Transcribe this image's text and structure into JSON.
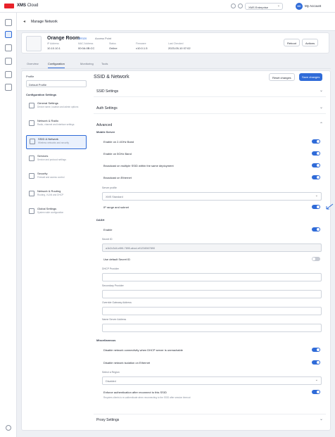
{
  "topbar": {
    "brand_bold": "XMS",
    "brand_rest": "Cloud",
    "account": "XMS Enterprise",
    "avatar_initials": "XC",
    "user_name": "My Account"
  },
  "breadcrumb": {
    "title": "Manage Network"
  },
  "room": {
    "name": "Orange Room",
    "badge": "XR320",
    "subtitle": "Access Point",
    "meta": [
      {
        "label": "IP Address",
        "value": "10.10.10.1"
      },
      {
        "label": "MAC Address",
        "value": "00:0A:0B:CC"
      },
      {
        "label": "Status",
        "value": "Online"
      },
      {
        "label": "Firmware",
        "value": "v10.0.1.5"
      },
      {
        "label": "Last Checked",
        "value": "2023-05-10 07:02"
      }
    ],
    "buttons": {
      "reboot": "Reboot",
      "more": "Actions"
    }
  },
  "tabs": [
    "Overview",
    "Configuration",
    "Monitoring",
    "Tools"
  ],
  "left": {
    "profile_label": "Profile",
    "profile_value": "Default Profile",
    "section": "Configuration Settings",
    "items": [
      {
        "title": "General Settings",
        "desc": "Device name, location and admin options"
      },
      {
        "title": "Network & Radio",
        "desc": "Radio, channel and interface settings"
      },
      {
        "title": "SSID & Network",
        "desc": "Wireless networks and security"
      },
      {
        "title": "Services",
        "desc": "Service and protocol settings"
      },
      {
        "title": "Security",
        "desc": "Firewall and access control"
      },
      {
        "title": "Network & Routing",
        "desc": "Routing, VLAN and DHCP"
      },
      {
        "title": "Global Settings",
        "desc": "System wide configuration"
      }
    ]
  },
  "content": {
    "title": "SSID & Network",
    "btn_outline": "Reset changes",
    "btn_primary": "Save changes",
    "sections": {
      "ssid": "SSID Settings",
      "auth": "Auth Settings",
      "advanced": "Advanced",
      "proxy": "Proxy Settings"
    },
    "mobile_heading": "Mobile Server",
    "mobile_rows": [
      {
        "label": "Enable on 2.4GHz Band",
        "on": true
      },
      {
        "label": "Enable on 5GHz Band",
        "on": true
      },
      {
        "label": "Broadcast on multiple SSID within the same deployment",
        "on": true
      },
      {
        "label": "Broadcast on Ethernet",
        "on": true
      }
    ],
    "server_label": "Server profile",
    "server_value": "XMS Standard",
    "ip_range_label": "IP range and subnet",
    "dash_heading": "DASH",
    "enable_label": "Enable",
    "secret_label": "Secret ID",
    "secret_value": "a1b2c3d4-e5f6-7890-abcd-ef1234567890",
    "use_default_label": "Use default Secret ID",
    "fields": [
      "DHCP Provider",
      "Secondary Provider",
      "Override Gateway Address",
      "Name Server Address"
    ],
    "adv_heading": "Miscellaneous",
    "adv_rows": [
      {
        "label": "Disable network connectivity when DHCP server is unreachable",
        "on": true
      },
      {
        "label": "Disable network isolation on Ethernet",
        "on": true
      }
    ],
    "select_label": "Select a Region",
    "select_value": "Disabled",
    "last_row": "Enforce authentication after reconnect to this SSID",
    "last_help": "Requires clients to re-authenticate when reconnecting to the SSID after session timeout"
  }
}
